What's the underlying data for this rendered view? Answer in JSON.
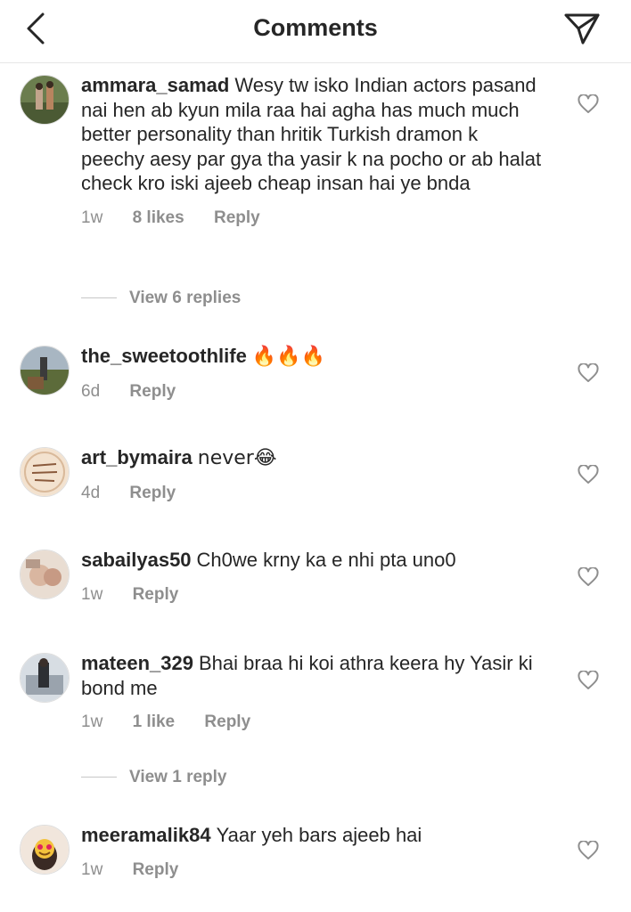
{
  "header": {
    "title": "Comments"
  },
  "comments": [
    {
      "username": "ammara_samad",
      "text": "Wesy tw isko Indian actors pasand nai hen ab kyun mila raa hai agha has much much better personality than hritik Turkish dramon k peechy aesy par gya tha yasir k na pocho or ab halat check kro iski ajeeb cheap insan hai ye bnda",
      "time": "1w",
      "likes": "8 likes",
      "reply": "Reply",
      "view_replies": "View 6 replies"
    },
    {
      "username": "the_sweetoothlife",
      "text": "🔥🔥🔥",
      "time": "6d",
      "reply": "Reply"
    },
    {
      "username": "art_bymaira",
      "text": "never😂",
      "time": "4d",
      "reply": "Reply"
    },
    {
      "username": "sabailyas50",
      "text": "Ch0we krny ka e nhi pta uno0",
      "time": "1w",
      "reply": "Reply"
    },
    {
      "username": "mateen_329",
      "text": "Bhai braa hi koi athra keera hy Yasir ki bond me",
      "time": "1w",
      "likes": "1 like",
      "reply": "Reply",
      "view_replies": "View 1 reply"
    },
    {
      "username": "meeramalik84",
      "text": "Yaar yeh bars ajeeb hai",
      "time": "1w",
      "reply": "Reply"
    }
  ],
  "avatars": {
    "a1": "Lifeis ART live yours",
    "a1_colors": [
      "#f3e2cf",
      "#8a5a3c"
    ]
  }
}
